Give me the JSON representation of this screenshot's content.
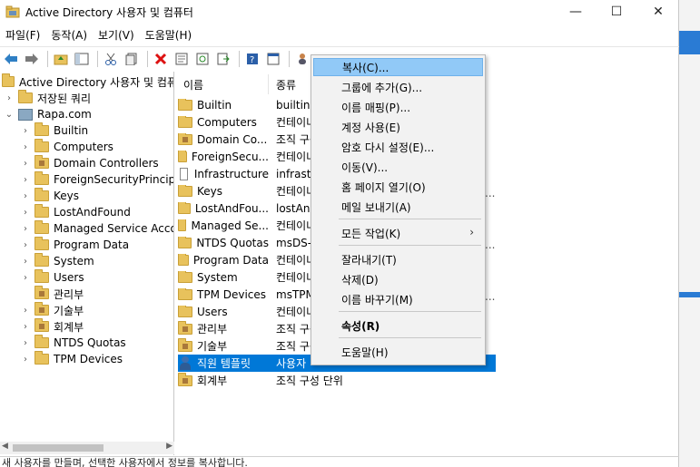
{
  "window": {
    "title": "Active Directory 사용자 및 컴퓨터",
    "controls": {
      "minimize": "—",
      "maximize": "☐",
      "close": "✕"
    }
  },
  "menubar": [
    "파일(F)",
    "동작(A)",
    "보기(V)",
    "도움말(H)"
  ],
  "toolbar": {
    "icons": [
      "back-icon",
      "forward-icon",
      "up-folder-icon",
      "show-tree-icon",
      "cut-icon",
      "copy-icon",
      "delete-icon",
      "properties-icon",
      "refresh-icon",
      "export-icon",
      "help-icon",
      "console-icon",
      "new-user-icon",
      "new-group-icon",
      "new-ou-icon",
      "filter-icon",
      "add-to-group-icon",
      "find-icon"
    ]
  },
  "tree": {
    "root": "Active Directory 사용자 및 컴퓨터",
    "saved_queries": "저장된 쿼리",
    "domain": "Rapa.com",
    "children": [
      "Builtin",
      "Computers",
      "Domain Controllers",
      "ForeignSecurityPrincipals",
      "Keys",
      "LostAndFound",
      "Managed Service Accounts",
      "Program Data",
      "System",
      "Users",
      "관리부",
      "기술부",
      "회계부",
      "NTDS Quotas",
      "TPM Devices"
    ]
  },
  "list": {
    "columns": [
      "이름",
      "종류"
    ],
    "rows": [
      {
        "name": "Builtin",
        "type": "builtinDomain"
      },
      {
        "name": "Computers",
        "type": "컨테이너"
      },
      {
        "name": "Domain Co...",
        "type": "조직 구성 단위"
      },
      {
        "name": "ForeignSecu...",
        "type": "컨테이너"
      },
      {
        "name": "Infrastructure",
        "type": "infrastructureUpdate"
      },
      {
        "name": "Keys",
        "type": "컨테이너"
      },
      {
        "name": "LostAndFou...",
        "type": "lostAndFound"
      },
      {
        "name": "Managed Se...",
        "type": "컨테이너"
      },
      {
        "name": "NTDS Quotas",
        "type": "msDS-QuotaContainer"
      },
      {
        "name": "Program Data",
        "type": "컨테이너"
      },
      {
        "name": "System",
        "type": "컨테이너"
      },
      {
        "name": "TPM Devices",
        "type": "msTPM-InformationObjectsContainer"
      },
      {
        "name": "Users",
        "type": "컨테이너"
      },
      {
        "name": "관리부",
        "type": "조직 구성 단위"
      },
      {
        "name": "기술부",
        "type": "조직 구성 단위"
      },
      {
        "name": "직원 템플릿",
        "type": "사용자"
      },
      {
        "name": "회계부",
        "type": "조직 구성 단위"
      }
    ],
    "trailing_dots": "..."
  },
  "context_menu": {
    "items": [
      {
        "label": "복사(C)...",
        "highlight": true
      },
      {
        "label": "그룹에 추가(G)..."
      },
      {
        "label": "이름 매핑(P)..."
      },
      {
        "label": "계정 사용(E)"
      },
      {
        "label": "암호 다시 설정(E)..."
      },
      {
        "label": "이동(V)..."
      },
      {
        "label": "홈 페이지 열기(O)"
      },
      {
        "label": "메일 보내기(A)"
      },
      {
        "label": "모든 작업(K)",
        "submenu": "›"
      },
      {
        "label": "잘라내기(T)"
      },
      {
        "label": "삭제(D)"
      },
      {
        "label": "이름 바꾸기(M)"
      },
      {
        "label": "속성(R)",
        "bold": true
      },
      {
        "label": "도움말(H)"
      }
    ]
  },
  "status": "새 사용자를 만들며, 선택한 사용자에서 정보를 복사합니다.",
  "colors": {
    "selection": "#0078d7",
    "menu_highlight": "#91c9f7",
    "folder": "#e8c25c"
  }
}
